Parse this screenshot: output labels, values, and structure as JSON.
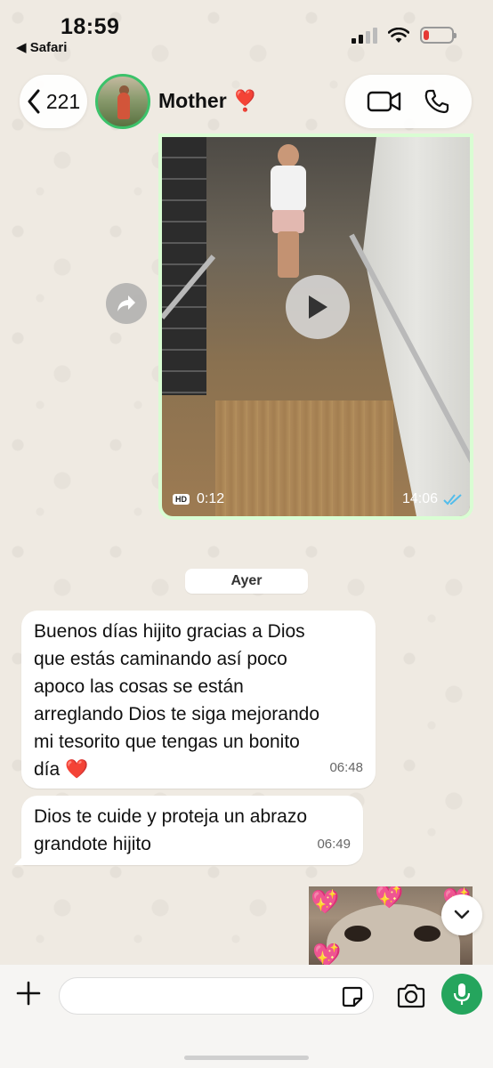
{
  "status_bar": {
    "time": "18:59",
    "back_app": "◀ Safari",
    "battery_level": 0.2,
    "battery_color": "#e53935"
  },
  "header": {
    "back_count": "221",
    "contact_name": "Mother",
    "contact_emoji": "❣️",
    "icons": [
      "chevron-left-icon",
      "video-call-icon",
      "phone-icon"
    ]
  },
  "video_message": {
    "duration": "0:12",
    "hd_label": "HD",
    "time": "14:06",
    "status": "read",
    "bubble_color": "#d9fdd3"
  },
  "date_separator": "Ayer",
  "messages": [
    {
      "text": "Buenos días hijito gracias a Dios\nque estás caminando así poco\napoco las cosas se están\narreglando Dios te siga mejorando\nmi tesorito que tengas un bonito\ndía ❤️",
      "time": "06:48"
    },
    {
      "text": "Dios te cuide y proteja un abrazo\ngrandote hijito",
      "time": "06:49"
    }
  ],
  "composer": {
    "placeholder": "",
    "accent": "#25a55d",
    "icons": [
      "plus-icon",
      "sticker-icon",
      "camera-icon",
      "microphone-icon"
    ]
  }
}
